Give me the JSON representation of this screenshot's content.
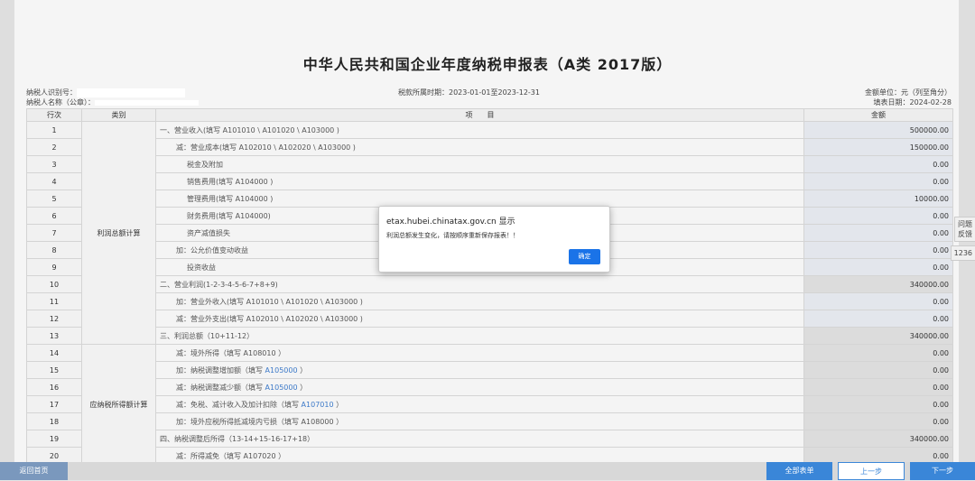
{
  "title": "中华人民共和国企业年度纳税申报表（A类 2017版）",
  "meta": {
    "taxpayer_id_label": "纳税人识别号：",
    "taxpayer_name_label": "纳税人名称（公章）：",
    "period": "税款所属时期：2023-01-01至2023-12-31",
    "unit": "金额单位：元（列至角分）",
    "fill_date": "填表日期：2024-02-28"
  },
  "headers": {
    "no": "行次",
    "category": "类别",
    "item": "项　　目",
    "amount": "金额"
  },
  "categories": {
    "profit": "利润总额计算",
    "taxable": "应纳税所得额计算"
  },
  "rows": [
    {
      "no": "1",
      "item": "一、营业收入(填写 A101010 \\ A101020 \\ A103000 )",
      "amount": "500000.00"
    },
    {
      "no": "2",
      "item": "减：营业成本(填写 A102010 \\ A102020 \\ A103000 )",
      "amount": "150000.00"
    },
    {
      "no": "3",
      "item": "税金及附加",
      "amount": "0.00"
    },
    {
      "no": "4",
      "item": "销售费用(填写 A104000 )",
      "amount": "0.00"
    },
    {
      "no": "5",
      "item": "管理费用(填写 A104000 )",
      "amount": "10000.00"
    },
    {
      "no": "6",
      "item": "财务费用(填写 A104000)",
      "amount": "0.00"
    },
    {
      "no": "7",
      "item": "资产减值损失",
      "amount": "0.00"
    },
    {
      "no": "8",
      "item": "加：公允价值变动收益",
      "amount": "0.00"
    },
    {
      "no": "9",
      "item": "投资收益",
      "amount": "0.00"
    },
    {
      "no": "10",
      "item": "二、营业利润(1-2-3-4-5-6-7+8+9)",
      "amount": "340000.00"
    },
    {
      "no": "11",
      "item": "加：营业外收入(填写 A101010 \\ A101020 \\ A103000 )",
      "amount": "0.00"
    },
    {
      "no": "12",
      "item": "减：营业外支出(填写 A102010 \\ A102020 \\ A103000 )",
      "amount": "0.00"
    },
    {
      "no": "13",
      "item": "三、利润总额（10+11-12）",
      "amount": "340000.00"
    },
    {
      "no": "14",
      "item": "减：境外所得（填写 A108010 ）",
      "amount": "0.00"
    },
    {
      "no": "15",
      "item_prefix": "加：纳税调整增加额（填写 ",
      "item_link": "A105000",
      "item_suffix": " ）",
      "amount": "0.00"
    },
    {
      "no": "16",
      "item_prefix": "减：纳税调整减少额（填写 ",
      "item_link": "A105000",
      "item_suffix": " ）",
      "amount": "0.00"
    },
    {
      "no": "17",
      "item_prefix": "减：免税、减计收入及加计扣除（填写 ",
      "item_link": "A107010",
      "item_suffix": " ）",
      "amount": "0.00"
    },
    {
      "no": "18",
      "item": "加：境外应税所得抵减境内亏损（填写 A108000 ）",
      "amount": "0.00"
    },
    {
      "no": "19",
      "item": "四、纳税调整后所得（13-14+15-16-17+18）",
      "amount": "340000.00"
    },
    {
      "no": "20",
      "item": "减：所得减免（填写 A107020 ）",
      "amount": "0.00"
    }
  ],
  "dialog": {
    "header": "etax.hubei.chinatax.gov.cn 显示",
    "message": "利润总额发生变化，请按顺序重新保存报表！！",
    "ok": "确定"
  },
  "side_tabs": {
    "feedback1": "问题",
    "feedback2": "反馈",
    "hotline": "1236"
  },
  "buttons": {
    "home": "返回首页",
    "all_forms": "全部表单",
    "prev": "上一步",
    "next": "下一步"
  }
}
